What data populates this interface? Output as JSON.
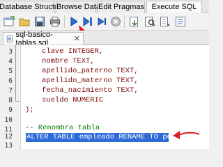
{
  "tabs": [
    {
      "label": "Database Structure"
    },
    {
      "label": "Browse Data"
    },
    {
      "label": "Edit Pragmas"
    },
    {
      "label": "Execute SQL"
    }
  ],
  "file_tab": {
    "name": "sql-basico-tablas.sql"
  },
  "editor": {
    "lines": [
      {
        "num": "3",
        "text": "clave INTEGER,"
      },
      {
        "num": "4",
        "text": "nombre TEXT,"
      },
      {
        "num": "5",
        "text": "apellido_paterno TEXT,"
      },
      {
        "num": "6",
        "text": "apellido_materno TEXT,"
      },
      {
        "num": "7",
        "text": "fecha_nacimiento TEXT,"
      },
      {
        "num": "8",
        "text": "sueldo NUMERIC"
      },
      {
        "num": "9",
        "text": ");"
      },
      {
        "num": "10",
        "text": ""
      },
      {
        "num": "11",
        "text": "-- Renombra tabla"
      },
      {
        "num": "12",
        "text": "ALTER TABLE empleado RENAME TO persona;"
      },
      {
        "num": "13",
        "text": ""
      }
    ]
  },
  "colors": {
    "annotation": "#e0191f",
    "selection": "#2d6bd8",
    "accent": "#2a6fd1"
  }
}
